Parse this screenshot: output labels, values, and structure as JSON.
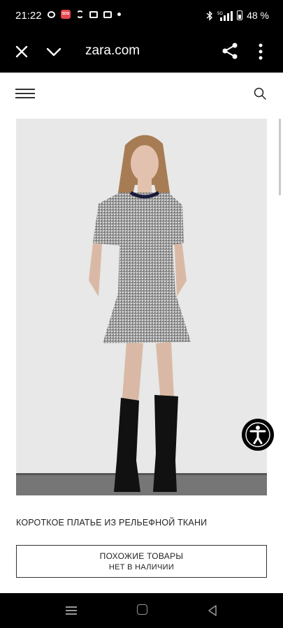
{
  "status_bar": {
    "time": "21:22",
    "battery": "48 %",
    "network": "5G"
  },
  "browser": {
    "url": "zara.com"
  },
  "product": {
    "name": "КОРОТКОЕ ПЛАТЬЕ ИЗ РЕЛЬЕФНОЙ ТКАНИ",
    "similar_label": "ПОХОЖИЕ ТОВАРЫ",
    "stock_status": "НЕТ В НАЛИЧИИ"
  },
  "colors": {
    "background": "#ffffff",
    "bars": "#000000",
    "sos_badge": "#e34850",
    "image_backdrop": "#e7e8e7"
  }
}
